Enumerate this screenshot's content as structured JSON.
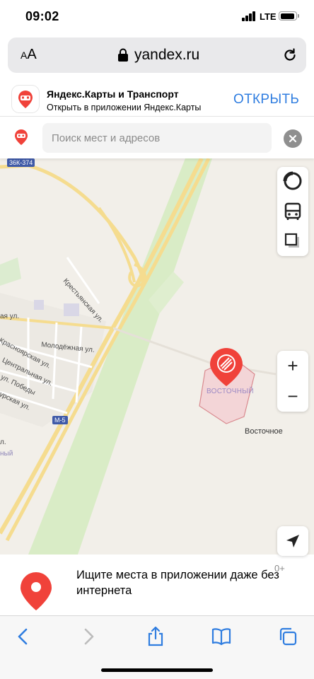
{
  "status_bar": {
    "time": "09:02",
    "network": "LTE"
  },
  "address_bar": {
    "aa_label": "AA",
    "url": "yandex.ru"
  },
  "app_banner": {
    "title": "Яндекс.Карты и Транспорт",
    "subtitle": "Открыть в приложении Яндекс.Карты",
    "open_label": "ОТКРЫТЬ"
  },
  "search": {
    "placeholder": "Поиск мест и адресов"
  },
  "map": {
    "road_signs": {
      "top": "36К-374",
      "m5": "М-5"
    },
    "streets": {
      "krestyanskaya": "Крестьянская ул.",
      "aya": "ая ул.",
      "molodezhnaya": "Молодёжная ул.",
      "krasnoyarskaya": "Красноярская ул.",
      "tsentralnaya": "Центральная ул.",
      "pobedy": "ул. Победы",
      "urskaya": "урская ул.",
      "l": "л.",
      "nyi": "ный"
    },
    "polygon_label": "ВОСТОЧНЫЙ",
    "place_label": "Восточное",
    "zoom_in": "+",
    "zoom_out": "−"
  },
  "promo": {
    "text": "Ищите места в приложении даже без интернета",
    "age": "0+"
  },
  "colors": {
    "accent": "#2f7de0",
    "brand_red": "#f0423a",
    "map_bg": "#f2efe9",
    "road": "#f4d98a"
  }
}
